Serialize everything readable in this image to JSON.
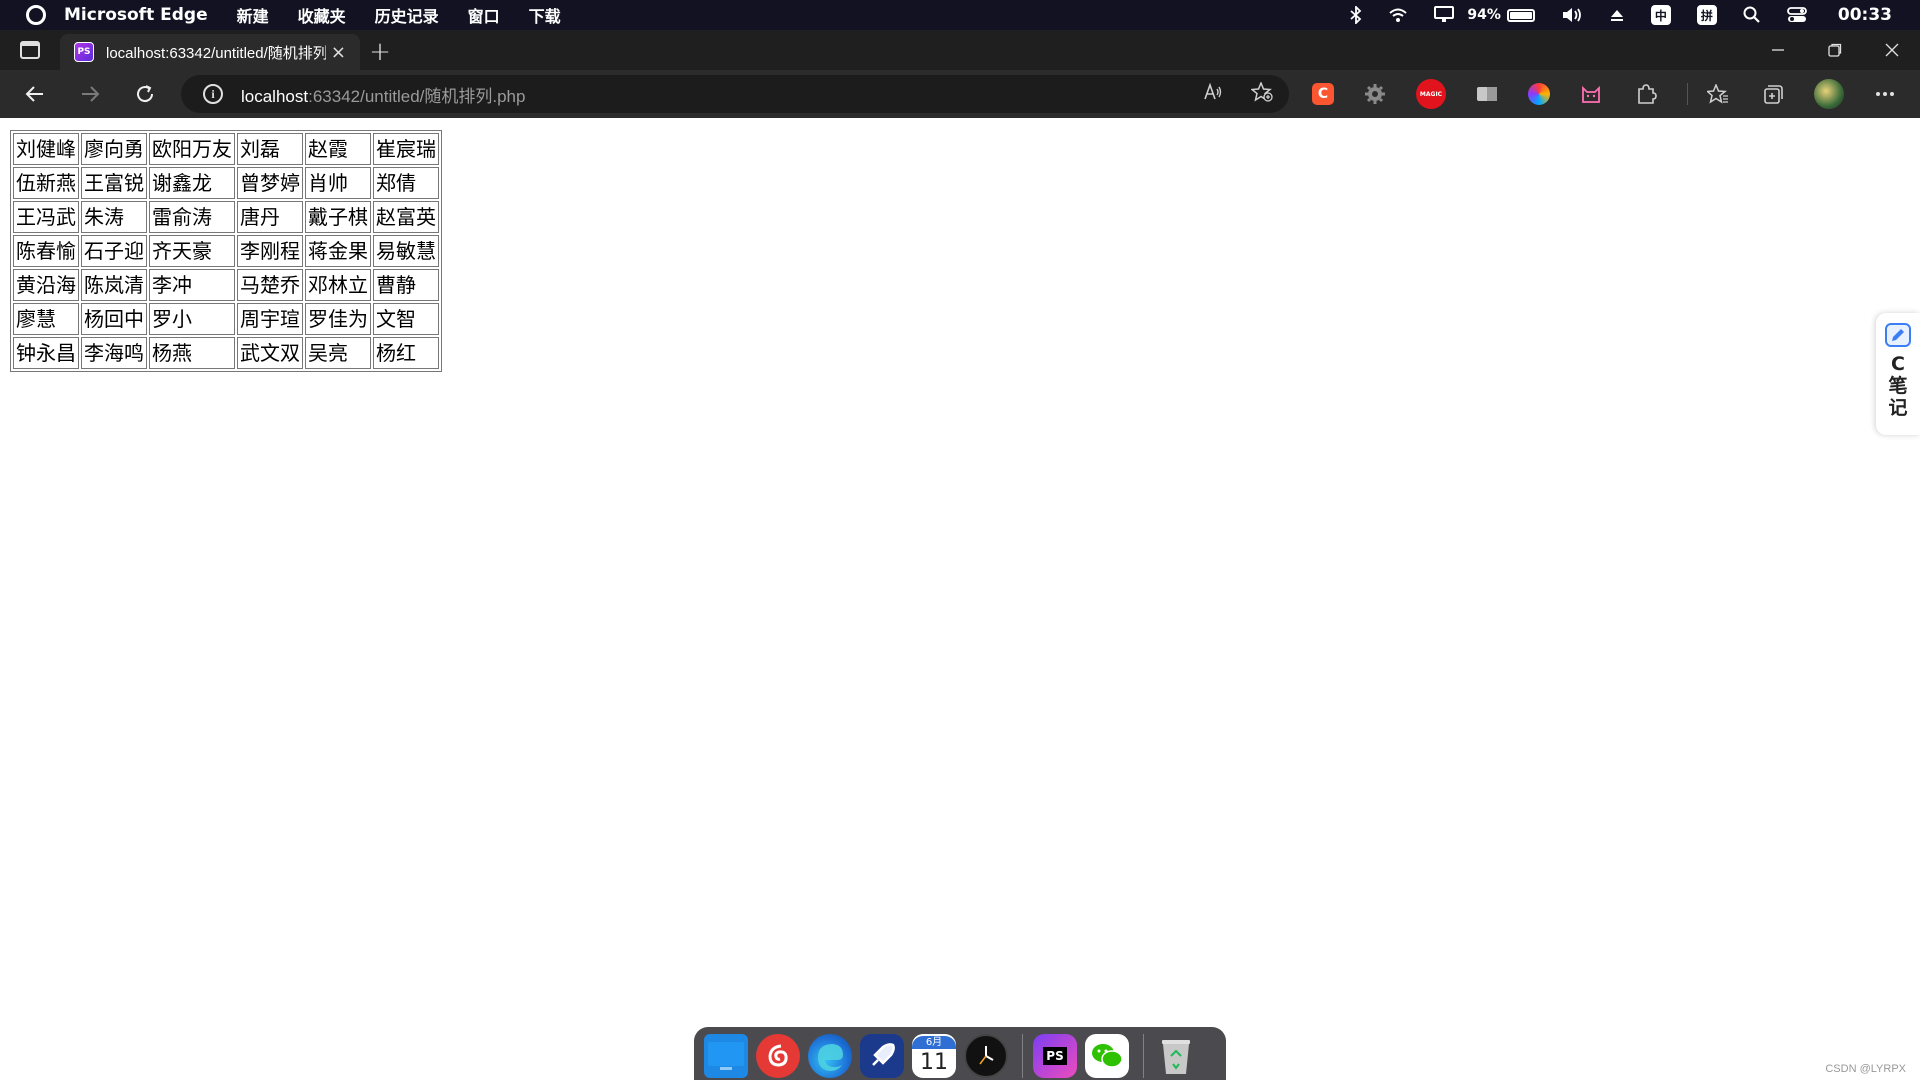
{
  "menubar": {
    "app_name": "Microsoft Edge",
    "items": [
      "新建",
      "收藏夹",
      "历史记录",
      "窗口",
      "下载"
    ],
    "battery_percent": "94%",
    "input_method_1": "中",
    "input_method_2": "拼",
    "clock": "00:33"
  },
  "tab": {
    "favicon_text": "PS",
    "title": "localhost:63342/untitled/随机排列",
    "close_label": "×",
    "new_tab_label": "+"
  },
  "address_bar": {
    "url_host": "localhost",
    "url_path": ":63342/untitled/随机排列.php"
  },
  "extensions": {
    "csdn_label": "C",
    "magic_label": "MAGIC"
  },
  "table": {
    "rows": [
      [
        "刘健峰",
        "廖向勇",
        "欧阳万友",
        "刘磊",
        "赵霞",
        "崔宸瑞"
      ],
      [
        "伍新燕",
        "王富锐",
        "谢鑫龙",
        "曾梦婷",
        "肖帅",
        "郑倩"
      ],
      [
        "王冯武",
        "朱涛",
        "雷俞涛",
        "唐丹",
        "戴子棋",
        "赵富英"
      ],
      [
        "陈春愉",
        "石子迎",
        "齐天豪",
        "李刚程",
        "蒋金果",
        "易敏慧"
      ],
      [
        "黄沿海",
        "陈岚清",
        "李冲",
        "马楚乔",
        "邓林立",
        "曹静"
      ],
      [
        "廖慧",
        "杨回中",
        "罗小",
        "周宇瑄",
        "罗佳为",
        "文智"
      ],
      [
        "钟永昌",
        "李海鸣",
        "杨燕",
        "武文双",
        "吴亮",
        "杨红"
      ]
    ]
  },
  "side_widget": {
    "label": "C笔记"
  },
  "dock": {
    "calendar_month": "6月",
    "calendar_day": "11",
    "phpstorm_label": "PS"
  },
  "watermark": "CSDN @LYRPX",
  "colors": {
    "menubar_bg": "#121223",
    "tabstrip_bg": "#1f1f1f",
    "toolbar_bg": "#2b2b2b",
    "omnibox_bg": "#1c1c1c",
    "csdn_red": "#fc5531",
    "page_bg": "#ffffff"
  }
}
